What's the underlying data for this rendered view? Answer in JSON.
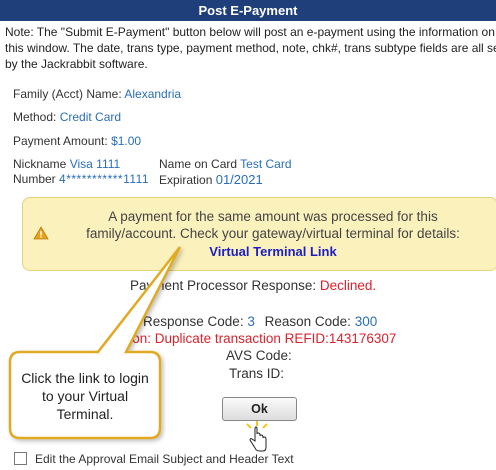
{
  "header": {
    "title": "Post E-Payment"
  },
  "note": {
    "line1": "Note: The \"Submit E-Payment\" button below will post an e-payment using the information on",
    "line2": "this window. The date, trans type, payment method, note, chk#, trans subtype fields are all set",
    "line3": "by the Jackrabbit software."
  },
  "family": {
    "label": "Family (Acct) Name:",
    "value": "Alexandria"
  },
  "method": {
    "label": "Method:",
    "value": "Credit Card"
  },
  "amount": {
    "label": "Payment Amount:",
    "value": "$1.00"
  },
  "card": {
    "nickname_label": "Nickname",
    "nickname_value": "Visa 1111",
    "number_label": "Number",
    "number_value": "4***********1111",
    "name_label": "Name on Card",
    "name_value": "Test Card",
    "expiration_label": "Expiration",
    "expiration_value": "01/2021"
  },
  "warning": {
    "icon": "warning-icon",
    "line1": "A payment for the same amount was processed for this",
    "line2": "family/account. Check your gateway/virtual terminal for details:",
    "link": "Virtual Terminal Link"
  },
  "response": {
    "processor_label": "Payment Processor Response:",
    "processor_value": "Declined.",
    "response_code_label": "Response Code:",
    "response_code_value": "3",
    "reason_code_label": "Reason Code:",
    "reason_code_value": "300",
    "reason_label_partial": "ason:",
    "reason_value": "Duplicate transaction REFID:143176307",
    "avs_label": "AVS Code:",
    "trans_label": "Trans ID:"
  },
  "ok_button": {
    "label": "Ok"
  },
  "checkbox": {
    "label": "Edit the Approval Email Subject and Header Text"
  },
  "callout": {
    "text": "Click the link to login to your Virtual Terminal."
  },
  "colors": {
    "header_bg": "#1f3f7a",
    "link_blue": "#2a6ebb",
    "error_red": "#d9232d",
    "warning_bg": "#fbf1bd",
    "callout_border": "#e0aa24"
  }
}
